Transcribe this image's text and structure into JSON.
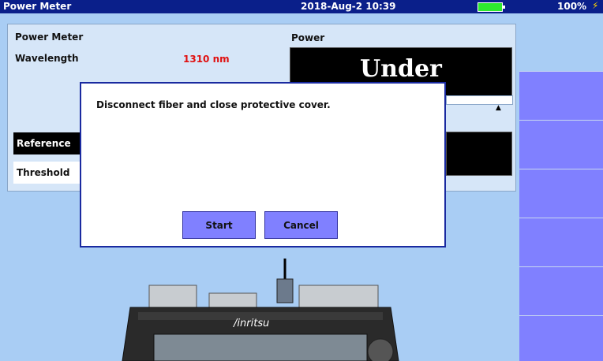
{
  "titlebar": {
    "title": "Power Meter",
    "datetime": "2018-Aug-2 10:39",
    "battery": "100%",
    "battery_level": 1.0
  },
  "panel": {
    "heading": "Power Meter",
    "wavelength_label": "Wavelength",
    "wavelength_value": "1310 nm",
    "power_label": "Power",
    "power_value": "Under",
    "reference_label": "Reference",
    "threshold_label": "Threshold"
  },
  "dialog": {
    "message": "Disconnect fiber and close protective cover.",
    "start_label": "Start",
    "cancel_label": "Cancel"
  },
  "device": {
    "brand": "/inritsu"
  },
  "colors": {
    "title_bar": "#0a1f8a",
    "background": "#a9cdf4",
    "accent_button": "#8080ff",
    "wavelength": "#e01010"
  }
}
